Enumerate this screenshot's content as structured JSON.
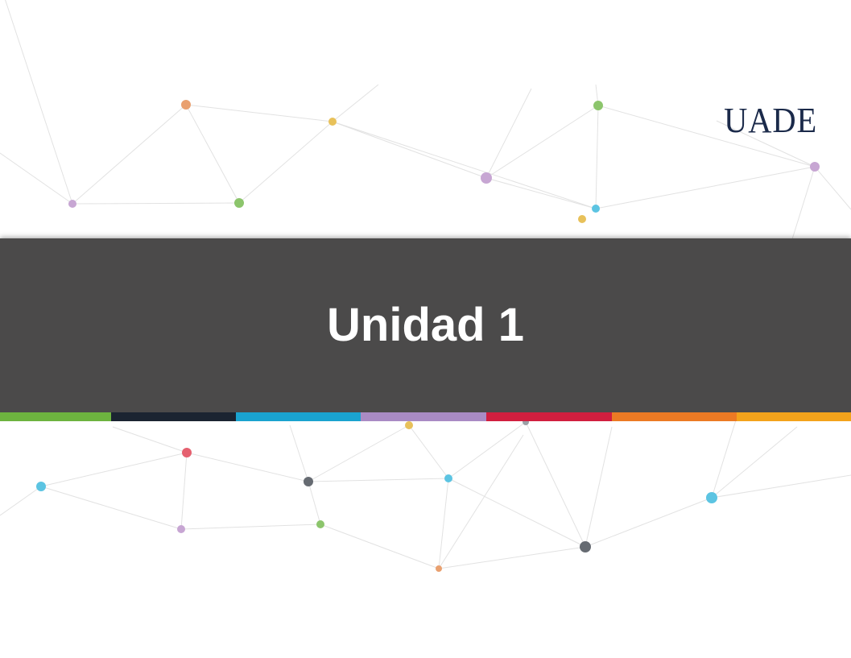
{
  "slide": {
    "title": "Unidad 1",
    "logo_text": "UADE"
  },
  "colors": {
    "band": "#4b4a4a",
    "title_text": "#ffffff",
    "logo": "#1b2a4a",
    "stripe": [
      "#6db33f",
      "#1b2431",
      "#1aa3cf",
      "#a98bc4",
      "#d11f3f",
      "#ec7a24",
      "#f3a31b"
    ]
  }
}
